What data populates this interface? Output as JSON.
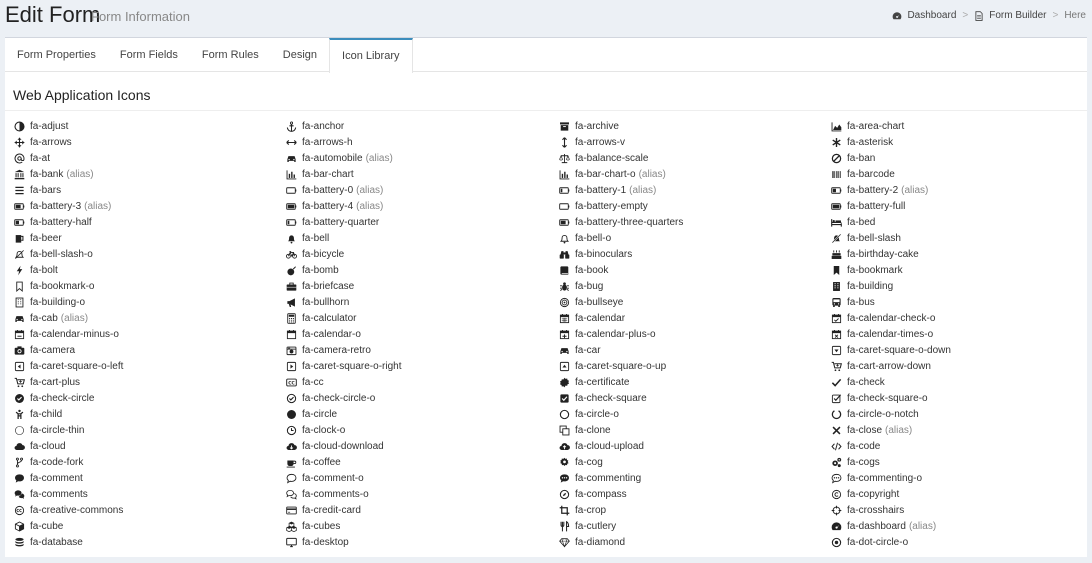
{
  "header": {
    "title": "Edit Form",
    "subtitle": "Form Information"
  },
  "breadcrumb": [
    {
      "label": "Dashboard",
      "icon": "dashboard-icon"
    },
    {
      "label": "Form Builder",
      "icon": "file-icon"
    },
    {
      "label": "Here",
      "icon": ""
    }
  ],
  "breadcrumb_separator": ">",
  "tabs": [
    {
      "label": "Form Properties",
      "active": false
    },
    {
      "label": "Form Fields",
      "active": false
    },
    {
      "label": "Form Rules",
      "active": false
    },
    {
      "label": "Design",
      "active": false
    },
    {
      "label": "Icon Library",
      "active": true
    }
  ],
  "section": {
    "title": "Web Application Icons"
  },
  "alias_label": "(alias)",
  "colors": {
    "accent": "#3c8dbc",
    "background": "#ecf0f5",
    "alias": "#888888"
  },
  "icons": [
    [
      "fa-adjust",
      ""
    ],
    [
      "fa-anchor",
      ""
    ],
    [
      "fa-archive",
      ""
    ],
    [
      "fa-area-chart",
      ""
    ],
    [
      "fa-arrows",
      ""
    ],
    [
      "fa-arrows-h",
      ""
    ],
    [
      "fa-arrows-v",
      ""
    ],
    [
      "fa-asterisk",
      ""
    ],
    [
      "fa-at",
      ""
    ],
    [
      "fa-automobile",
      "(alias)"
    ],
    [
      "fa-balance-scale",
      ""
    ],
    [
      "fa-ban",
      ""
    ],
    [
      "fa-bank",
      "(alias)"
    ],
    [
      "fa-bar-chart",
      ""
    ],
    [
      "fa-bar-chart-o",
      "(alias)"
    ],
    [
      "fa-barcode",
      ""
    ],
    [
      "fa-bars",
      ""
    ],
    [
      "fa-battery-0",
      "(alias)"
    ],
    [
      "fa-battery-1",
      "(alias)"
    ],
    [
      "fa-battery-2",
      "(alias)"
    ],
    [
      "fa-battery-3",
      "(alias)"
    ],
    [
      "fa-battery-4",
      "(alias)"
    ],
    [
      "fa-battery-empty",
      ""
    ],
    [
      "fa-battery-full",
      ""
    ],
    [
      "fa-battery-half",
      ""
    ],
    [
      "fa-battery-quarter",
      ""
    ],
    [
      "fa-battery-three-quarters",
      ""
    ],
    [
      "fa-bed",
      ""
    ],
    [
      "fa-beer",
      ""
    ],
    [
      "fa-bell",
      ""
    ],
    [
      "fa-bell-o",
      ""
    ],
    [
      "fa-bell-slash",
      ""
    ],
    [
      "fa-bell-slash-o",
      ""
    ],
    [
      "fa-bicycle",
      ""
    ],
    [
      "fa-binoculars",
      ""
    ],
    [
      "fa-birthday-cake",
      ""
    ],
    [
      "fa-bolt",
      ""
    ],
    [
      "fa-bomb",
      ""
    ],
    [
      "fa-book",
      ""
    ],
    [
      "fa-bookmark",
      ""
    ],
    [
      "fa-bookmark-o",
      ""
    ],
    [
      "fa-briefcase",
      ""
    ],
    [
      "fa-bug",
      ""
    ],
    [
      "fa-building",
      ""
    ],
    [
      "fa-building-o",
      ""
    ],
    [
      "fa-bullhorn",
      ""
    ],
    [
      "fa-bullseye",
      ""
    ],
    [
      "fa-bus",
      ""
    ],
    [
      "fa-cab",
      "(alias)"
    ],
    [
      "fa-calculator",
      ""
    ],
    [
      "fa-calendar",
      ""
    ],
    [
      "fa-calendar-check-o",
      ""
    ],
    [
      "fa-calendar-minus-o",
      ""
    ],
    [
      "fa-calendar-o",
      ""
    ],
    [
      "fa-calendar-plus-o",
      ""
    ],
    [
      "fa-calendar-times-o",
      ""
    ],
    [
      "fa-camera",
      ""
    ],
    [
      "fa-camera-retro",
      ""
    ],
    [
      "fa-car",
      ""
    ],
    [
      "fa-caret-square-o-down",
      ""
    ],
    [
      "fa-caret-square-o-left",
      ""
    ],
    [
      "fa-caret-square-o-right",
      ""
    ],
    [
      "fa-caret-square-o-up",
      ""
    ],
    [
      "fa-cart-arrow-down",
      ""
    ],
    [
      "fa-cart-plus",
      ""
    ],
    [
      "fa-cc",
      ""
    ],
    [
      "fa-certificate",
      ""
    ],
    [
      "fa-check",
      ""
    ],
    [
      "fa-check-circle",
      ""
    ],
    [
      "fa-check-circle-o",
      ""
    ],
    [
      "fa-check-square",
      ""
    ],
    [
      "fa-check-square-o",
      ""
    ],
    [
      "fa-child",
      ""
    ],
    [
      "fa-circle",
      ""
    ],
    [
      "fa-circle-o",
      ""
    ],
    [
      "fa-circle-o-notch",
      ""
    ],
    [
      "fa-circle-thin",
      ""
    ],
    [
      "fa-clock-o",
      ""
    ],
    [
      "fa-clone",
      ""
    ],
    [
      "fa-close",
      "(alias)"
    ],
    [
      "fa-cloud",
      ""
    ],
    [
      "fa-cloud-download",
      ""
    ],
    [
      "fa-cloud-upload",
      ""
    ],
    [
      "fa-code",
      ""
    ],
    [
      "fa-code-fork",
      ""
    ],
    [
      "fa-coffee",
      ""
    ],
    [
      "fa-cog",
      ""
    ],
    [
      "fa-cogs",
      ""
    ],
    [
      "fa-comment",
      ""
    ],
    [
      "fa-comment-o",
      ""
    ],
    [
      "fa-commenting",
      ""
    ],
    [
      "fa-commenting-o",
      ""
    ],
    [
      "fa-comments",
      ""
    ],
    [
      "fa-comments-o",
      ""
    ],
    [
      "fa-compass",
      ""
    ],
    [
      "fa-copyright",
      ""
    ],
    [
      "fa-creative-commons",
      ""
    ],
    [
      "fa-credit-card",
      ""
    ],
    [
      "fa-crop",
      ""
    ],
    [
      "fa-crosshairs",
      ""
    ],
    [
      "fa-cube",
      ""
    ],
    [
      "fa-cubes",
      ""
    ],
    [
      "fa-cutlery",
      ""
    ],
    [
      "fa-dashboard",
      "(alias)"
    ],
    [
      "fa-database",
      ""
    ],
    [
      "fa-desktop",
      ""
    ],
    [
      "fa-diamond",
      ""
    ],
    [
      "fa-dot-circle-o",
      ""
    ]
  ]
}
